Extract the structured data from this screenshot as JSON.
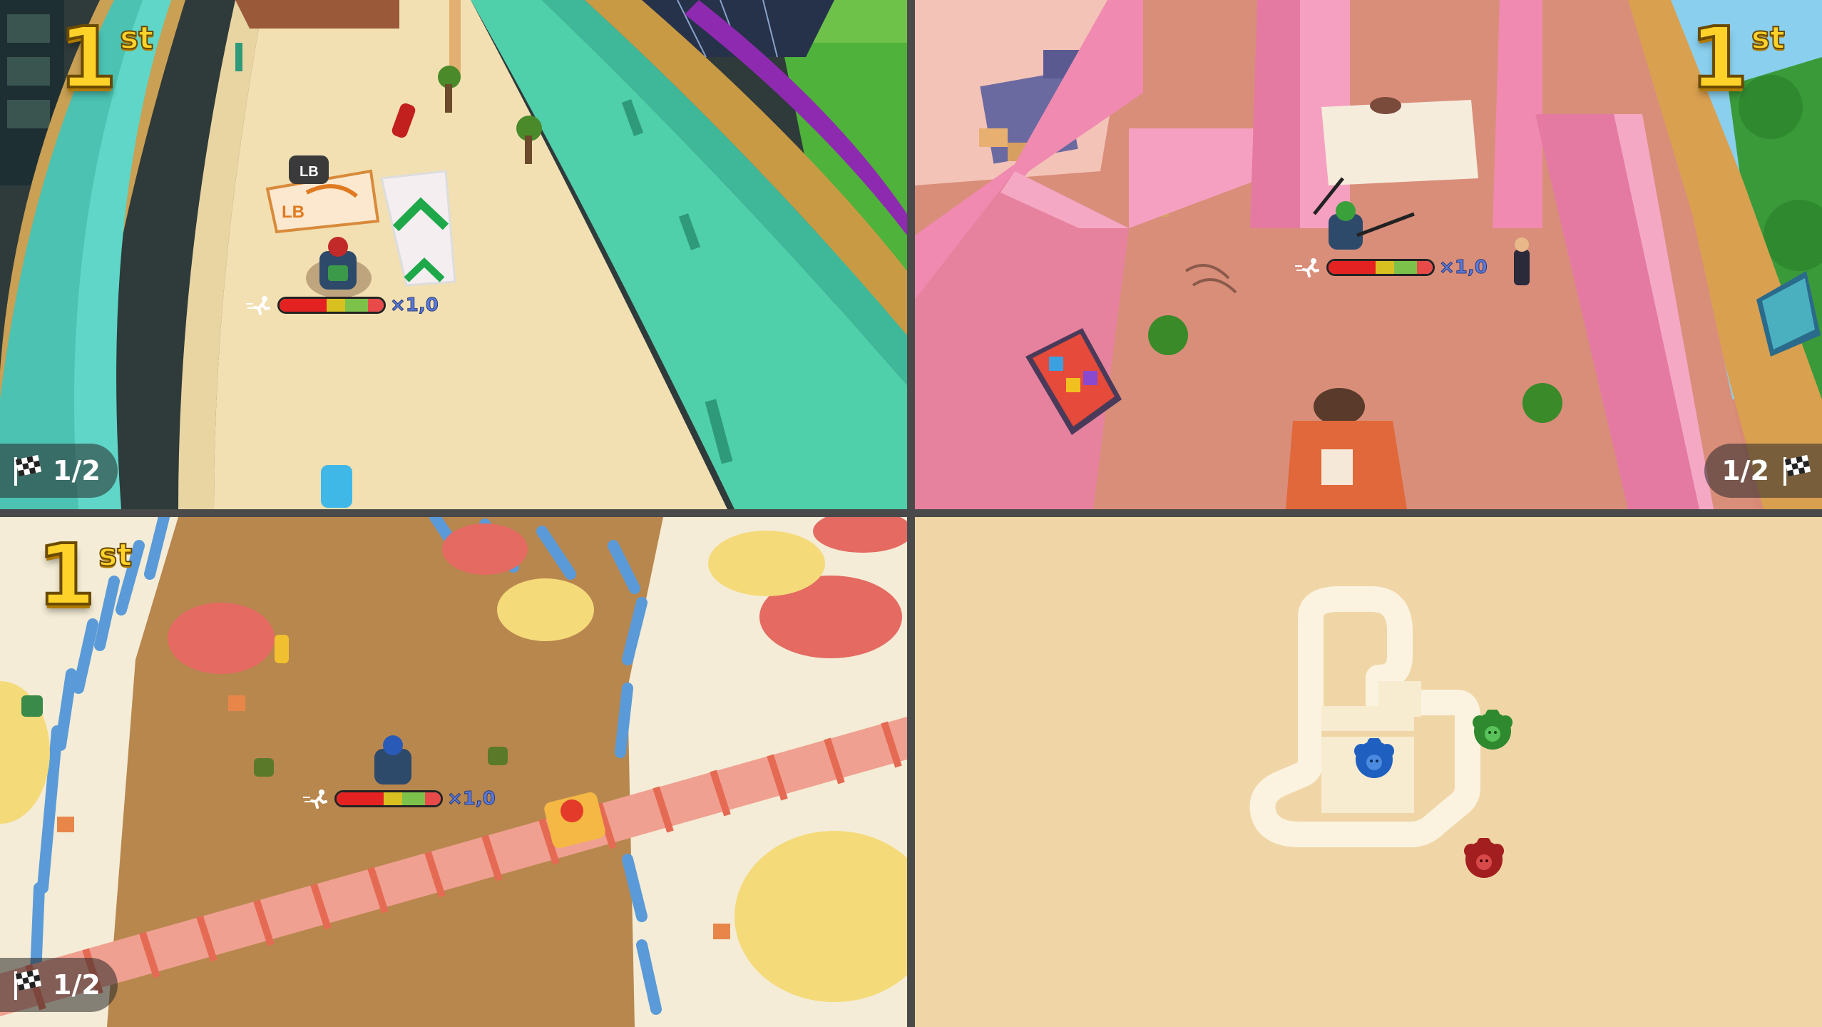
{
  "players": [
    {
      "id": "p1",
      "position": "1",
      "position_suffix": "st",
      "lap": "1/2",
      "speed_multiplier": "×1,0",
      "boost_level": 0.45
    },
    {
      "id": "p2",
      "position": "1",
      "position_suffix": "st",
      "lap": "1/2",
      "speed_multiplier": "×1,0",
      "boost_level": 0.45
    },
    {
      "id": "p3",
      "position": "1",
      "position_suffix": "st",
      "lap": "1/2",
      "speed_multiplier": "×1,0",
      "boost_level": 0.45
    }
  ],
  "p1_scene": {
    "sign_button": "LB",
    "sign_text": "LB"
  },
  "minimap": {
    "racers": [
      {
        "name": "green-racer",
        "color": "#2f8a2f"
      },
      {
        "name": "blue-racer",
        "color": "#1f5fbf"
      },
      {
        "name": "red-racer",
        "color": "#a31f1f"
      }
    ]
  },
  "colors": {
    "place_gold": "#ffd22a",
    "boost_red": "#e52222",
    "boost_yellow": "#d8c020",
    "boost_green": "#7cc24a",
    "multiplier_blue": "#5a7ad8"
  },
  "icons": {
    "lap": "checkered-flag-icon",
    "boost": "running-man-icon"
  }
}
